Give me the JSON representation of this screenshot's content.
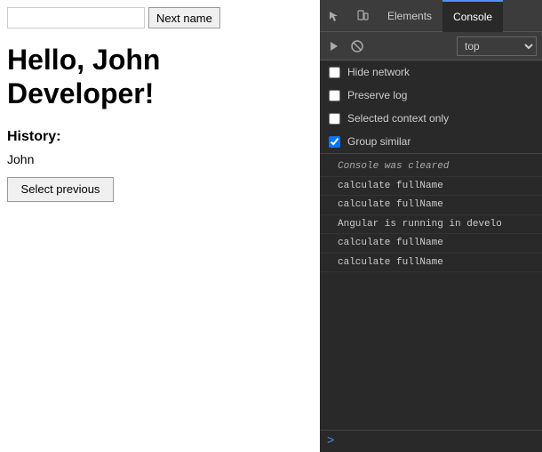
{
  "left": {
    "name_input_value": "",
    "next_name_btn": "Next name",
    "greeting": "Hello, John Developer!",
    "history_label": "History:",
    "history_item": "John",
    "select_prev_btn": "Select previous"
  },
  "devtools": {
    "tabs": [
      {
        "label": "Elements",
        "active": false
      },
      {
        "label": "Console",
        "active": true
      }
    ],
    "toolbar": {
      "context_options": [
        "top"
      ],
      "context_selected": "top"
    },
    "options": [
      {
        "id": "hide-network",
        "label": "Hide network",
        "checked": false
      },
      {
        "id": "preserve-log",
        "label": "Preserve log",
        "checked": false
      },
      {
        "id": "selected-context",
        "label": "Selected context only",
        "checked": false
      },
      {
        "id": "group-similar",
        "label": "Group similar",
        "checked": true
      }
    ],
    "console_lines": [
      {
        "type": "cleared",
        "text": "Console was cleared"
      },
      {
        "type": "log",
        "text": "calculate fullName"
      },
      {
        "type": "log",
        "text": "calculate fullName"
      },
      {
        "type": "angular",
        "text": "Angular is running in develo"
      },
      {
        "type": "log",
        "text": "calculate fullName"
      },
      {
        "type": "log",
        "text": "calculate fullName"
      }
    ],
    "prompt": ">"
  }
}
